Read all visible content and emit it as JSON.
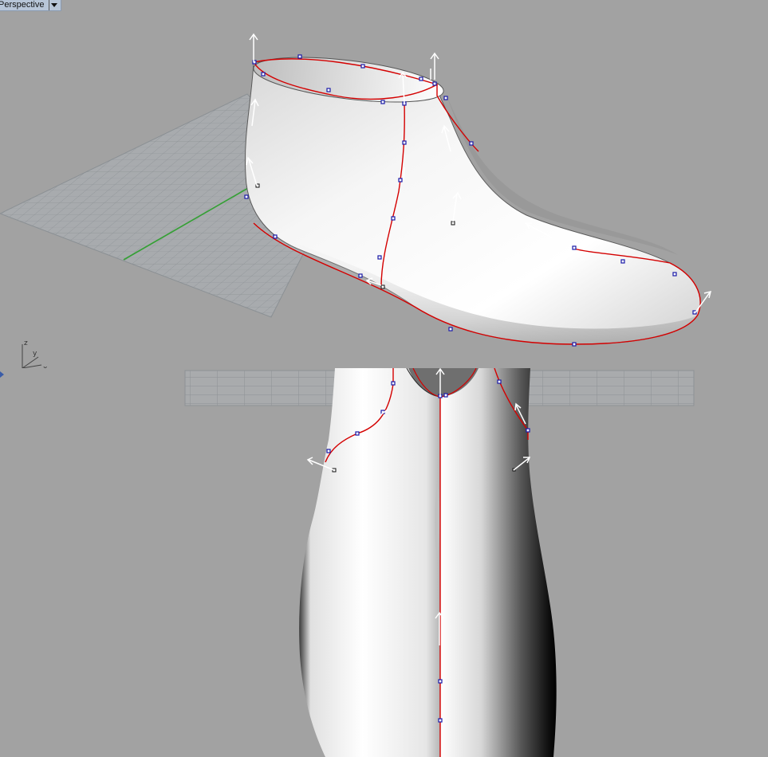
{
  "viewport": {
    "label": "Perspective",
    "menu_icon": "chevron-down-icon"
  },
  "axis_widget": {
    "z": "z",
    "y": "y",
    "x": "x"
  },
  "colors": {
    "background": "#a2a2a2",
    "grid_line": "#8c9196",
    "grid_fill": "#a7aaad",
    "curve": "#d40000",
    "control_point": "#1a1aa8",
    "y_axis_line": "#35a035",
    "normal_arrow": "#ffffff"
  }
}
